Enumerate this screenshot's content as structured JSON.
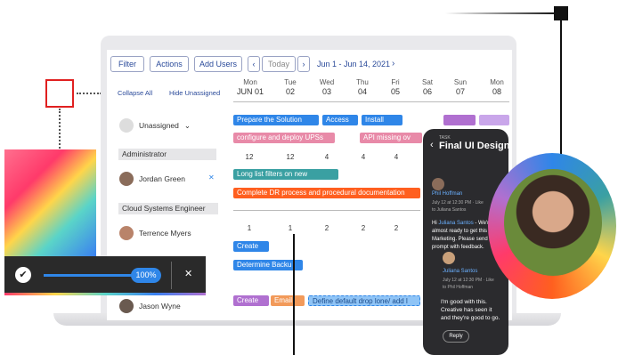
{
  "toolbar": {
    "filter": "Filter",
    "actions": "Actions",
    "add_users": "Add Users",
    "prev": "‹",
    "today": "Today",
    "next": "›",
    "range": "Jun 1 - Jun 14, 2021",
    "range_next": "›"
  },
  "sidebar": {
    "collapse": "Collapse All",
    "hide_unassigned": "Hide Unassigned",
    "unassigned": "Unassigned",
    "group_admin": "Administrator",
    "user1": "Jordan Green",
    "group_cloud": "Cloud Systems Engineer",
    "user2": "Terrence Myers",
    "user3": "Jason Wyne"
  },
  "days": [
    {
      "d": "Mon",
      "n": "JUN 01"
    },
    {
      "d": "Tue",
      "n": "02"
    },
    {
      "d": "Wed",
      "n": "03"
    },
    {
      "d": "Thu",
      "n": "04"
    },
    {
      "d": "Fri",
      "n": "05"
    },
    {
      "d": "Sat",
      "n": "06"
    },
    {
      "d": "Sun",
      "n": "07"
    },
    {
      "d": "Mon",
      "n": "08"
    }
  ],
  "tasks": {
    "t1": "Prepare the Solution",
    "t2": "Access",
    "t3": "Install",
    "t4": "configure and deploy UPSs",
    "t5": "API missing ov",
    "t6": "Long list filters on new",
    "t7": "Complete DR process and procedural documentation",
    "t8": "Create",
    "t9": "Determine Backu",
    "t10": "Create",
    "t11": "Email",
    "t12": "Define default drop lone/ add l"
  },
  "counts_row1": [
    "12",
    "12",
    "4",
    "4",
    "4"
  ],
  "counts_row2": [
    "1",
    "1",
    "2",
    "2",
    "2"
  ],
  "phone": {
    "tag": "TASK",
    "title": "Final UI Design",
    "user1": "Phil Hoffman",
    "meta1": "July 12 at 12:30 PM · Like",
    "to1": "to Juliana Santos",
    "msg1a": "Hi ",
    "msg1link": "Juliana Santos",
    "msg1b": " - We're almost ready to get this to Marketing. Please send me a prompt with feedback.",
    "user2": "Juliana Santos",
    "meta2": "July 12 at 12:30 PM · Like",
    "to2": "to Phil Hoffman",
    "msg2": "I'm good with this. Creative has seen it and they're good to go.",
    "reply": "Reply"
  },
  "progress": {
    "value": "100%",
    "check": "✔",
    "close": "✕"
  },
  "colors": {
    "accent": "#2f86e8",
    "orange": "#ff5f1f",
    "pink": "#e88aa8",
    "teal": "#3aa0a2",
    "phone_bg": "#2b2b2e"
  }
}
